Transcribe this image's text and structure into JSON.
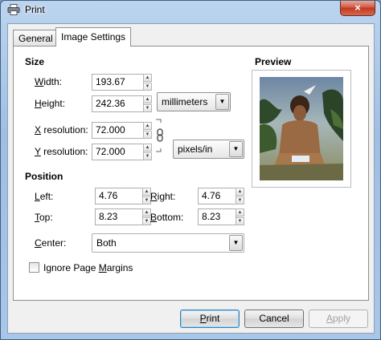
{
  "window": {
    "title": "Print",
    "close_glyph": "×"
  },
  "tabs": [
    {
      "label": "General"
    },
    {
      "label": "Image Settings"
    }
  ],
  "size": {
    "heading": "Size",
    "width_label_u": "W",
    "width_label_rest": "idth:",
    "width_value": "193.67",
    "height_label_u": "H",
    "height_label_rest": "eight:",
    "height_value": "242.36",
    "unit_value": "millimeters",
    "xres_label_u": "X",
    "xres_label_rest": " resolution:",
    "xres_value": "72.000",
    "yres_label_u": "Y",
    "yres_label_rest": " resolution:",
    "yres_value": "72.000",
    "res_unit_value": "pixels/in"
  },
  "position": {
    "heading": "Position",
    "left_label_u": "L",
    "left_label_rest": "eft:",
    "left_value": "4.76",
    "right_label_u": "R",
    "right_label_rest": "ight:",
    "right_value": "4.76",
    "top_label_u": "T",
    "top_label_rest": "op:",
    "top_value": "8.23",
    "bottom_label_u": "B",
    "bottom_label_rest": "ottom:",
    "bottom_value": "8.23",
    "center_label_u": "C",
    "center_label_rest": "enter:",
    "center_value": "Both"
  },
  "preview": {
    "heading": "Preview"
  },
  "ignore_margins": {
    "label_pre": "Ignore Page ",
    "label_u": "M",
    "label_rest": "argins",
    "checked": false
  },
  "buttons": {
    "print_u": "P",
    "print_rest": "rint",
    "cancel": "Cancel",
    "apply_u": "A",
    "apply_rest": "pply"
  },
  "spin_up_glyph": "▲",
  "spin_down_glyph": "▼",
  "combo_arrow_glyph": "▼"
}
